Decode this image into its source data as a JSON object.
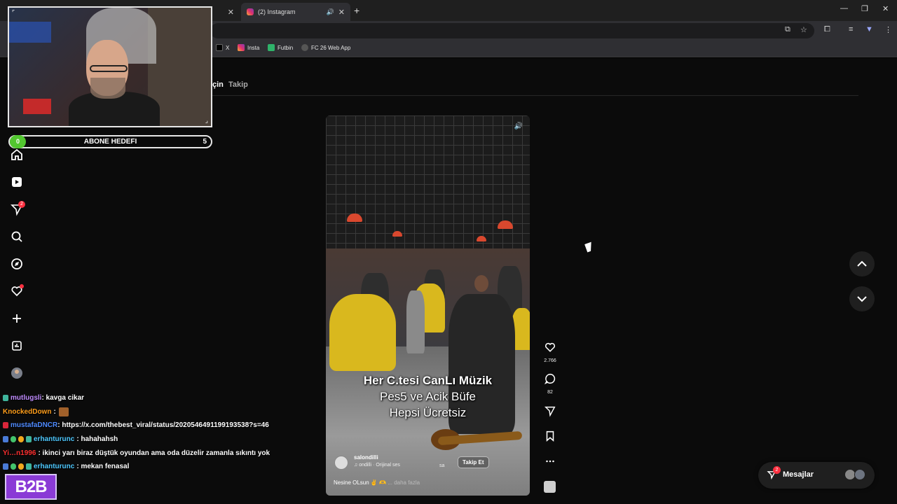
{
  "browser": {
    "tabs": [
      {
        "title": "",
        "active": false
      },
      {
        "title": "(2) Instagram",
        "active": true
      }
    ],
    "bookmarks": [
      {
        "label": "X",
        "icon": "x-logo-icon"
      },
      {
        "label": "Insta",
        "icon": "instagram-icon"
      },
      {
        "label": "Futbin",
        "icon": "futbin-icon"
      },
      {
        "label": "FC 26 Web App",
        "icon": "globe-icon"
      }
    ]
  },
  "instagram": {
    "top_tabs": {
      "for_you_partial": "çin",
      "following": "Takip"
    },
    "nav_badge_count": "2",
    "reel": {
      "overlay_lines": [
        "Her C.tesi CanLı Müzik",
        "Pes5 ve Acik Büfe",
        "Hepsi Ücretsiz"
      ],
      "username": "salondilli",
      "audio": "♫ ondilli · Orijinal ses",
      "audio_suffix": "sa",
      "follow_label": "Takip Et",
      "description": "Nesine OLsun ✌ 🫶",
      "more": "... daha fazla"
    },
    "actions": {
      "likes": "2.766",
      "comments": "82"
    },
    "messages": {
      "label": "Mesajlar",
      "badge": "2"
    }
  },
  "stream": {
    "goal": {
      "start": "0",
      "label": "ABONE HEDEFI",
      "end": "5"
    },
    "chat": [
      {
        "user": "mutlugsli",
        "text": ": kavga cikar",
        "color": "#c08cff"
      },
      {
        "user": "KnockedDown",
        "text": ":",
        "color": "#ff9e1b",
        "emote": true
      },
      {
        "user": "mustafaDNCR",
        "text": ": https://x.com/thebest_viral/status/2020546491199193538?s=46",
        "color": "#4f8bff"
      },
      {
        "user": "erhanturunc",
        "text": ": hahahahsh",
        "color": "#4ec9ff"
      },
      {
        "user": "Yi…n1996",
        "text": ": ikinci yarı biraz düştük oyundan ama oda düzelir zamanla sıkıntı yok",
        "color": "#ff3030"
      },
      {
        "user": "erhanturunc",
        "text": ": mekan fenasal",
        "color": "#4ec9ff"
      }
    ],
    "logo_text": "B2B"
  }
}
